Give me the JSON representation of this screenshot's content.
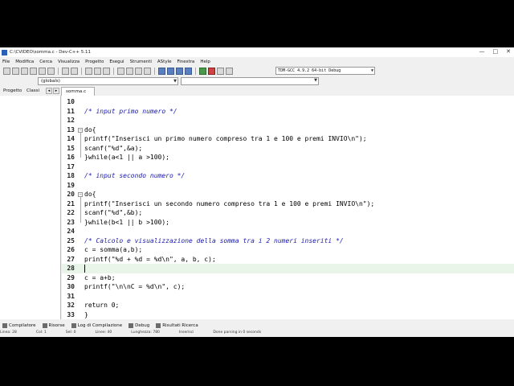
{
  "window": {
    "title": "C:\\CVIDEO\\somma.c - Dev-C++ 5.11",
    "buttons": [
      "—",
      "□",
      "✕"
    ]
  },
  "menu": [
    "File",
    "Modifica",
    "Cerca",
    "Visualizza",
    "Progetto",
    "Esegui",
    "Strumenti",
    "AStyle",
    "Finestra",
    "Help"
  ],
  "toolbar": {
    "compiler": "TDM-GCC 4.9.2 64-bit Debug"
  },
  "scope": {
    "selected": "(globals)"
  },
  "panel_tabs": [
    "Progetto",
    "Classi"
  ],
  "file_tab": "somma.c",
  "editor": {
    "current_line": 28,
    "lines": [
      {
        "n": "10",
        "t": ""
      },
      {
        "n": "11",
        "t": "/* input primo numero */",
        "type": "comment"
      },
      {
        "n": "12",
        "t": ""
      },
      {
        "n": "13",
        "t": "do{",
        "fold": true
      },
      {
        "n": "14",
        "t": "printf(\"Inserisci un primo numero compreso tra 1 e 100 e premi INVIO\\n\");"
      },
      {
        "n": "15",
        "t": "scanf(\"%d\",&a);"
      },
      {
        "n": "16",
        "t": "}while(a<1 || a >100);"
      },
      {
        "n": "17",
        "t": ""
      },
      {
        "n": "18",
        "t": "/* input secondo numero */",
        "type": "comment"
      },
      {
        "n": "19",
        "t": ""
      },
      {
        "n": "20",
        "t": "do{",
        "fold": true
      },
      {
        "n": "21",
        "t": "printf(\"Inserisci un secondo numero compreso tra 1 e 100 e premi INVIO\\n\");"
      },
      {
        "n": "22",
        "t": "scanf(\"%d\",&b);"
      },
      {
        "n": "23",
        "t": "}while(b<1 || b >100);"
      },
      {
        "n": "24",
        "t": ""
      },
      {
        "n": "25",
        "t": "/* Calcolo e visualizzazione della somma tra i 2 numeri inseriti */",
        "type": "comment"
      },
      {
        "n": "26",
        "t": "c = somma(a,b);"
      },
      {
        "n": "27",
        "t": "printf(\"%d + %d = %d\\n\", a, b, c);"
      },
      {
        "n": "28",
        "t": ""
      },
      {
        "n": "29",
        "t": "c = a+b;"
      },
      {
        "n": "30",
        "t": "printf(\"\\n\\nC = %d\\n\", c);"
      },
      {
        "n": "31",
        "t": ""
      },
      {
        "n": "32",
        "t": "return 0;"
      },
      {
        "n": "33",
        "t": "}"
      }
    ]
  },
  "bottom_tabs": [
    "Compilatore",
    "Risorse",
    "Log di Compilazione",
    "Debug",
    "Risultati Ricerca"
  ],
  "statusbar": [
    "Linea: 28",
    "Col: 1",
    "Sel: 0",
    "Linee: 40",
    "Lunghezza: 780",
    "Inserisci",
    "Done parsing in 0 seconds"
  ]
}
